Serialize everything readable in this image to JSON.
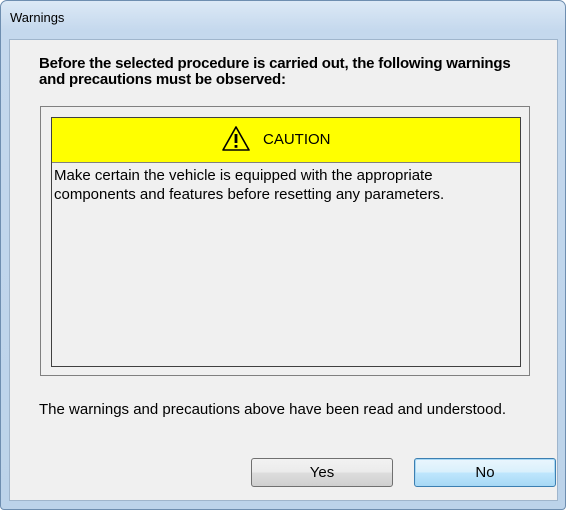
{
  "window": {
    "title": "Warnings"
  },
  "dialog": {
    "heading": "Before the selected procedure is carried out, the following warnings and precautions must be observed:",
    "warning": {
      "label": "CAUTION",
      "icon": "warning-triangle-icon",
      "text": "Make certain the vehicle is equipped with the appropriate components and features before resetting any parameters."
    },
    "acknowledgement": "The warnings and precautions above have been read and understood.",
    "buttons": {
      "yes_label": "Yes",
      "no_label": "No"
    }
  },
  "colors": {
    "caution_background": "#ffff00",
    "dialog_background": "#f0f0f0",
    "frame": "#bcd3ea"
  }
}
